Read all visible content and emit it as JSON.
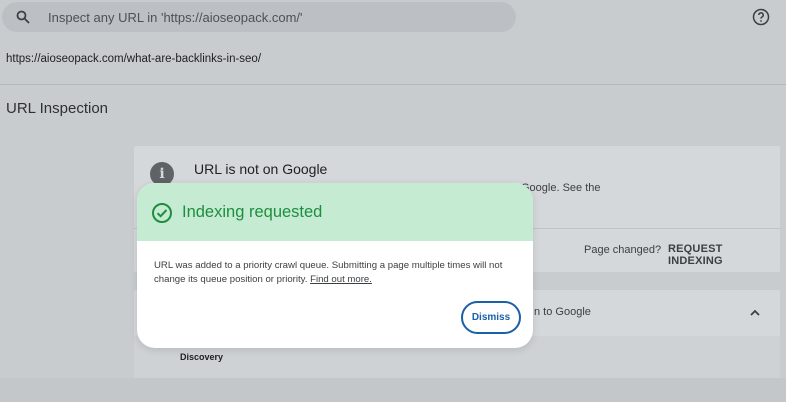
{
  "search": {
    "placeholder": "Inspect any URL in 'https://aioseopack.com/'"
  },
  "inspected_url": "https://aioseopack.com/what-are-backlinks-in-seo/",
  "page_title": "URL Inspection",
  "status_card": {
    "heading": "URL is not on Google",
    "subtext_fragment": "Google. See the",
    "page_changed": "Page changed?",
    "request_indexing": "REQUEST INDEXING"
  },
  "details_card": {
    "title_fragment": "n to Google",
    "discovery_label": "Discovery"
  },
  "dialog": {
    "title": "Indexing requested",
    "message": "URL was added to a priority crawl queue. Submitting a page multiple times will not change its queue position or priority. ",
    "link": "Find out more.",
    "dismiss": "Dismiss"
  },
  "icons": {
    "search": "search-icon",
    "help": "help-icon",
    "info": "info-icon",
    "check": "check-circle-icon",
    "chevron": "chevron-up-icon"
  },
  "colors": {
    "dialog_header": "#c5ecd3",
    "success_green": "#1e8e3e",
    "dismiss_blue": "#1a5fa8"
  }
}
